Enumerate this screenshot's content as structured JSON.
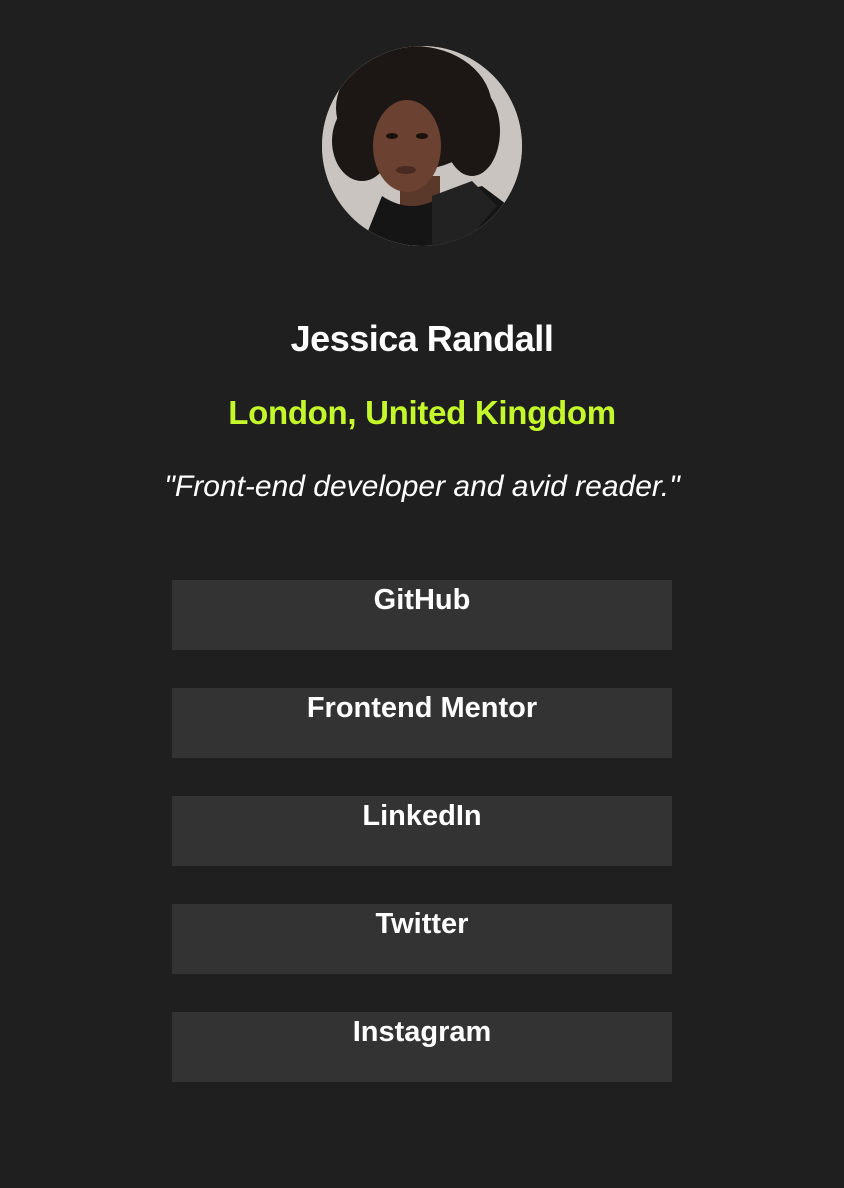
{
  "profile": {
    "avatar_alt": "Jessica Randall",
    "name": "Jessica Randall",
    "location": "London, United Kingdom",
    "bio": "\"Front-end developer and avid reader.\""
  },
  "links": [
    {
      "label": "GitHub"
    },
    {
      "label": "Frontend Mentor"
    },
    {
      "label": "LinkedIn"
    },
    {
      "label": "Twitter"
    },
    {
      "label": "Instagram"
    }
  ],
  "colors": {
    "background": "#1f1f1f",
    "button": "#333333",
    "accent": "#c4f82a",
    "text": "#ffffff"
  }
}
